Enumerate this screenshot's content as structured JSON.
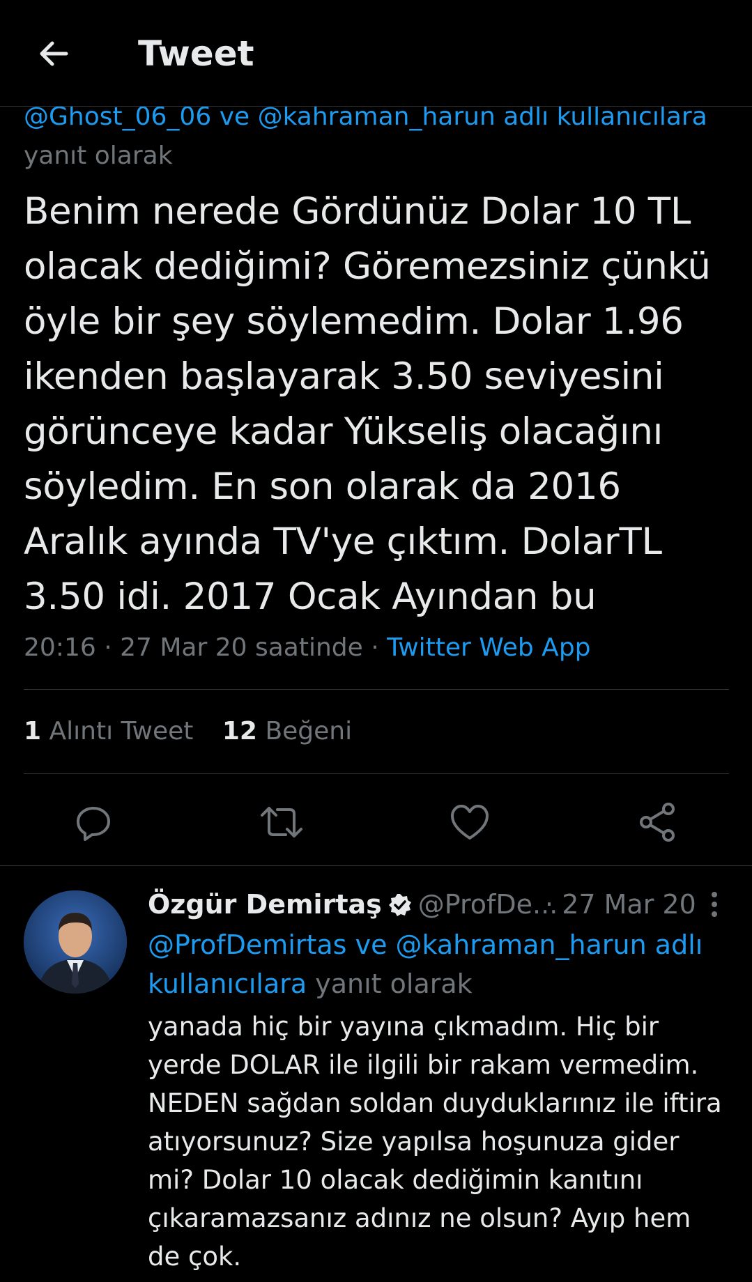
{
  "header": {
    "title": "Tweet",
    "back_icon": "arrow-left-icon"
  },
  "main_tweet": {
    "reply_mention_1": "@Ghost_06_06",
    "reply_connector": "ve",
    "reply_mention_2": "@kahraman_harun adlı kullanıcılara",
    "reply_suffix": "yanıt olarak",
    "text": "Benim nerede Gördünüz Dolar 10 TL olacak dediğimi? Göremezsiniz çünkü öyle bir şey söylemedim. Dolar 1.96 ikenden başlayarak 3.50 seviyesini görünceye kadar Yükseliş olacağını söyledim. En son olarak da 2016 Aralık ayında TV'ye çıktım. DolarTL 3.50 idi. 2017 Ocak Ayından bu",
    "time": "20:16",
    "date_text": "27 Mar 20 saatinde",
    "separator": "·",
    "source": "Twitter Web App",
    "stats": {
      "quotes_count": "1",
      "quotes_label": "Alıntı Tweet",
      "likes_count": "12",
      "likes_label": "Beğeni"
    }
  },
  "actions": [
    {
      "icon": "reply-icon"
    },
    {
      "icon": "retweet-icon"
    },
    {
      "icon": "like-icon"
    },
    {
      "icon": "share-icon"
    }
  ],
  "reply_tweet": {
    "name": "Özgür Demirtaş",
    "handle": "@ProfDe...",
    "separator": "·",
    "date": "27 Mar 20",
    "reply_mention_1": "@ProfDemirtas",
    "reply_connector": "ve",
    "reply_mention_2": "@kahraman_harun adlı kullanıcılara",
    "reply_suffix": "yanıt olarak",
    "text": "yanada hiç bir yayına çıkmadım. Hiç bir yerde DOLAR ile ilgili bir rakam vermedim. NEDEN sağdan soldan duyduklarınız ile iftira atıyorsunuz? Size yapılsa hoşunuza gider mi? Dolar 10 olacak dediğimin kanıtını çıkaramazsanız adınız ne olsun? Ayıp hem de çok."
  },
  "colors": {
    "background": "#000000",
    "text": "#e7e9ea",
    "secondary": "#71767b",
    "accent": "#1d9bf0",
    "divider": "#2f3336"
  }
}
